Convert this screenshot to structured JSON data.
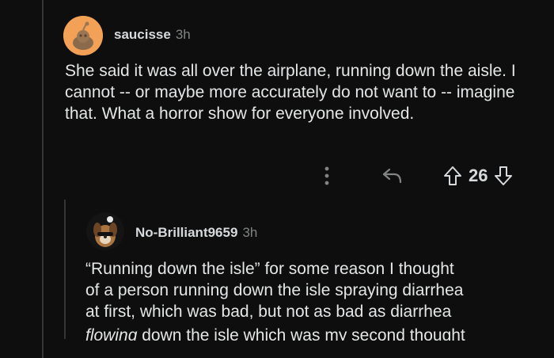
{
  "comments": [
    {
      "username": "saucisse",
      "time": "3h",
      "text": "She said it was all over the airplane, running down the aisle. I cannot -- or maybe more accurately do not want to -- imagine that. What a horror show for everyone involved.",
      "score": "26"
    },
    {
      "username": "No-Brilliant9659",
      "time": "3h",
      "lines": [
        "“Running down the isle” for some reason I thought",
        "of a person running down the isle spraying diarrhea",
        "at first, which was bad, but not as bad as diarrhea"
      ],
      "last_line_italic": "flowing",
      "last_line_rest": " down the isle which was my second thought"
    }
  ],
  "icons": {
    "more": "more-vertical-icon",
    "reply": "reply-arrow-icon",
    "upvote": "upvote-arrow-icon",
    "downvote": "downvote-arrow-icon"
  },
  "colors": {
    "background": "#0e0e0e",
    "text": "#d7dadc",
    "muted": "#818384",
    "avatar1": "#f2a157"
  }
}
